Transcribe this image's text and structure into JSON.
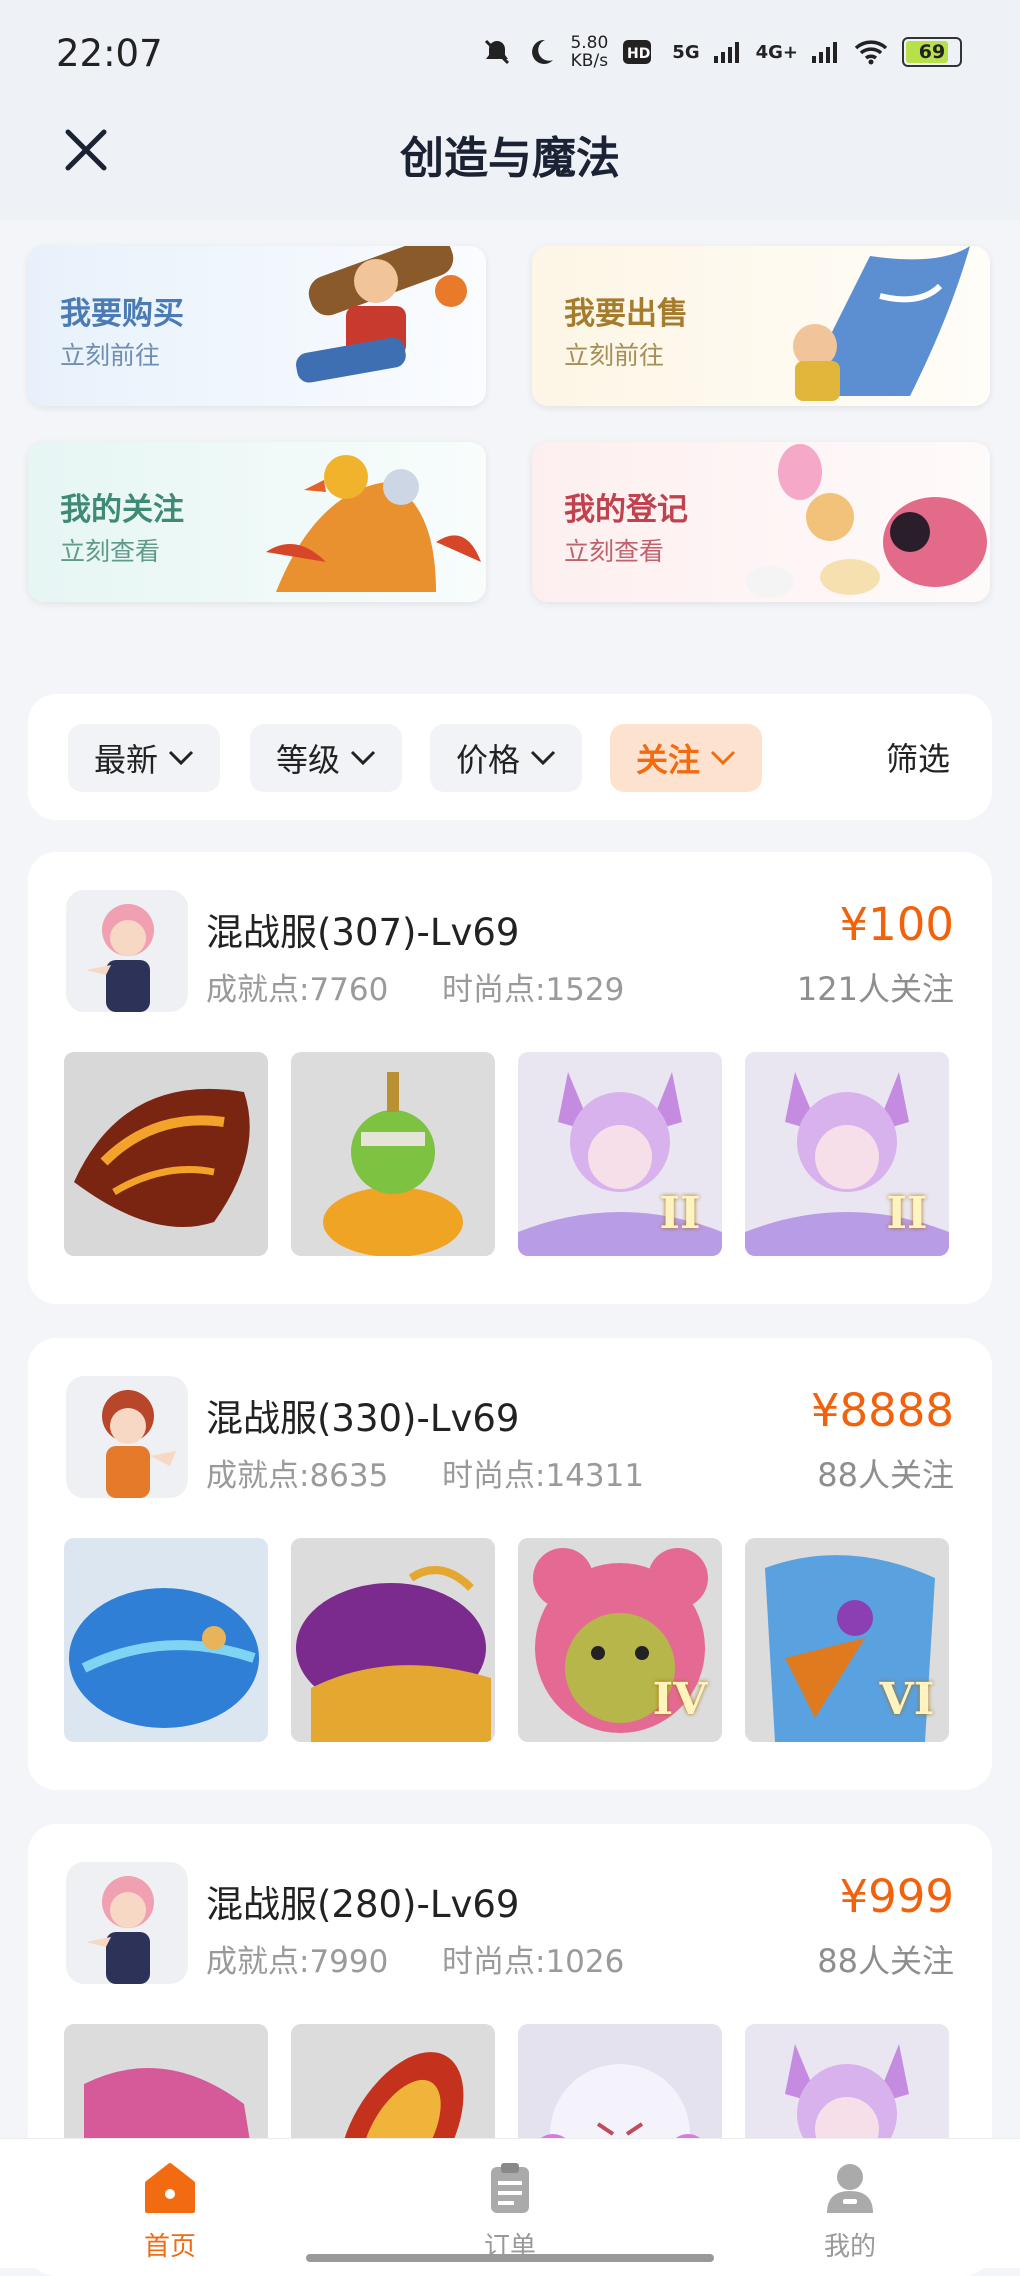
{
  "status": {
    "time": "22:07",
    "speed_value": "5.80",
    "speed_unit": "KB/s",
    "network_1": "5G",
    "network_2": "4G+",
    "battery": "69"
  },
  "header": {
    "title": "创造与魔法"
  },
  "quick_cards": [
    {
      "title": "我要购买",
      "subtitle": "立刻前往"
    },
    {
      "title": "我要出售",
      "subtitle": "立刻前往"
    },
    {
      "title": "我的关注",
      "subtitle": "立刻查看"
    },
    {
      "title": "我的登记",
      "subtitle": "立刻查看"
    }
  ],
  "filters": {
    "chips": [
      "最新",
      "等级",
      "价格",
      "关注"
    ],
    "active_chip": "关注",
    "filter_label": "筛选"
  },
  "listings": [
    {
      "server": "混战服(307)-Lv69",
      "achievement": "成就点:7760",
      "fashion": "时尚点:1529",
      "price": "¥100",
      "followers": "121人关注",
      "items": [
        "dragon",
        "zombie-pumpkin",
        "fox-girl",
        "fox-girl"
      ],
      "tiers": [
        "",
        "",
        "II",
        "II"
      ]
    },
    {
      "server": "混战服(330)-Lv69",
      "achievement": "成就点:8635",
      "fashion": "时尚点:14311",
      "price": "¥8888",
      "followers": "88人关注",
      "items": [
        "whale",
        "golden-whale",
        "pink-bear",
        "griffin"
      ],
      "tiers": [
        "",
        "",
        "IV",
        "VI"
      ]
    },
    {
      "server": "混战服(280)-Lv69",
      "achievement": "成就点:7990",
      "fashion": "时尚点:1026",
      "price": "¥999",
      "followers": "88人关注",
      "items": [
        "pink-dragon",
        "flame-board",
        "white-spirit",
        "fox-girl"
      ],
      "tiers": [
        "",
        "",
        "",
        ""
      ]
    }
  ],
  "bottom_nav": {
    "items": [
      "首页",
      "订单",
      "我的"
    ],
    "active": "首页"
  },
  "colors": {
    "accent": "#f26b10",
    "price": "#f2620c"
  }
}
